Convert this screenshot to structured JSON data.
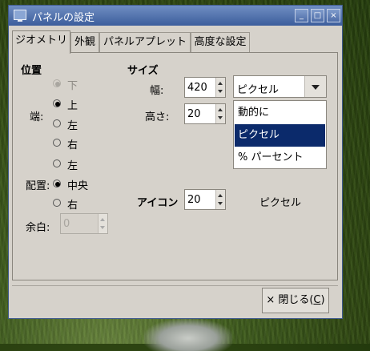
{
  "window": {
    "title": "パネルの設定",
    "minimize": "_",
    "maximize": "□",
    "close": "×"
  },
  "tabs": [
    {
      "label": "ジオメトリ"
    },
    {
      "label": "外観"
    },
    {
      "label": "パネルアプレット"
    },
    {
      "label": "高度な設定"
    }
  ],
  "position": {
    "heading": "位置",
    "edge_label": "端:",
    "edges": [
      {
        "label": "下",
        "selected": true,
        "disabled": true
      },
      {
        "label": "上",
        "selected": true
      },
      {
        "label": "左",
        "selected": false
      },
      {
        "label": "右",
        "selected": false
      }
    ],
    "align_label": "配置:",
    "aligns": [
      {
        "label": "左",
        "selected": false
      },
      {
        "label": "中央",
        "selected": true
      },
      {
        "label": "右",
        "selected": false
      }
    ],
    "margin_label": "余白:",
    "margin_value": "0"
  },
  "size": {
    "heading": "サイズ",
    "width_label": "幅:",
    "width_value": "420",
    "height_label": "高さ:",
    "height_value": "20",
    "unit_selected": "ピクセル",
    "unit_options": [
      "動的に",
      "ピクセル",
      "% パーセント"
    ],
    "icon_label": "アイコン",
    "icon_value": "20",
    "icon_unit": "ピクセル"
  },
  "footer": {
    "close_x": "×",
    "close_label": "閉じる(",
    "close_mnemonic": "C",
    "close_end": ")"
  },
  "colors": {
    "titlebar": "#3c5d9c",
    "selection": "#0b2a6b",
    "dialog_bg": "#d6d2cb"
  }
}
